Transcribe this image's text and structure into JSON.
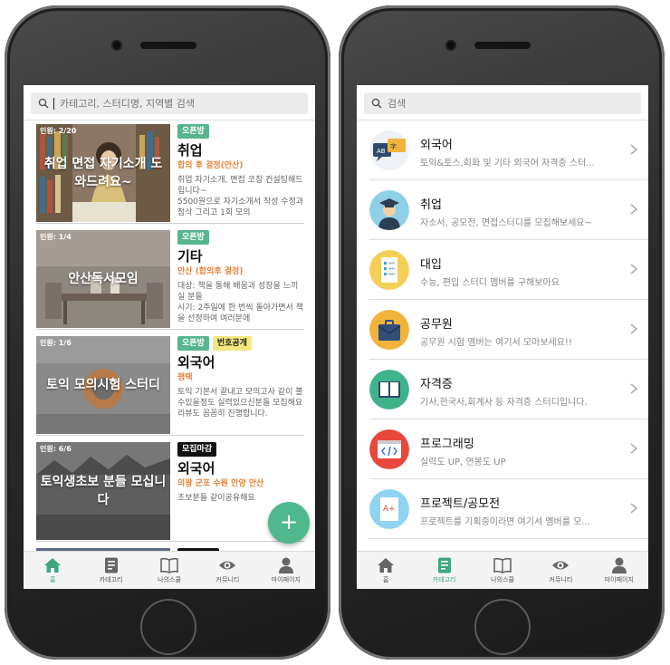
{
  "left_screen": {
    "search_placeholder": "카테고리, 스터디명, 지역별 검색",
    "cards": [
      {
        "count": "인원: 2/20",
        "thumb_title": "취업 면접 자기소개 도와드려요~",
        "tags": [
          "오픈방"
        ],
        "category": "취업",
        "place": "합의 후 결정(안산)",
        "desc": "취업 자기소개, 면접 코칭 컨설팅해드립니다~\n5500원으로 자기소개서 작성 수정과 첨삭 그리고 1회 모의"
      },
      {
        "count": "인원: 1/4",
        "thumb_title": "안산독서모임",
        "tags": [
          "오픈방"
        ],
        "category": "기타",
        "place": "안산 (합의후 결정)",
        "desc": "대상: 책을 통해 배움과 성장을 느끼실 분들\n시기: 2주일에 한 번씩 돌아가면서 책을 선정하여 여러분에"
      },
      {
        "count": "인원: 1/6",
        "thumb_title": "토익 모의시험 스터디",
        "tags": [
          "오픈방",
          "번호공개"
        ],
        "category": "외국어",
        "place": "평택",
        "desc": "토익 기본서 끝내고 모의고사 같이 볼수있을정도 실력있으신분들 모집해요 리뷰도 꼼꼼히 진행합니다."
      },
      {
        "count": "인원: 6/6",
        "thumb_title": "토익생초보 분들 모십니다",
        "tags": [
          "모집마감"
        ],
        "category": "외국어",
        "place": "의왕 군포 수원 안양 안산",
        "desc": "초보분들 같이공유해요"
      }
    ],
    "fab_label": "+"
  },
  "right_screen": {
    "search_placeholder": "검색",
    "categories": [
      {
        "title": "외국어",
        "subtitle": "토익&토스,회화 및 기타 외국어 자격증 스터...",
        "icon": "language-icon"
      },
      {
        "title": "취업",
        "subtitle": "자소서, 공모전, 면접스터디를 모집해보세요~",
        "icon": "graduate-icon"
      },
      {
        "title": "대입",
        "subtitle": "수능, 편입 스터디 멤버를 구해보아요",
        "icon": "checklist-icon"
      },
      {
        "title": "공무원",
        "subtitle": "공무원 시험 멤버는 여기서 모아보세요!!",
        "icon": "briefcase-icon"
      },
      {
        "title": "자격증",
        "subtitle": "기사,한국사,회계사 등 자격증 스터디입니다.",
        "icon": "book-icon"
      },
      {
        "title": "프로그래밍",
        "subtitle": "실력도 UP, 연봉도 UP",
        "icon": "code-icon"
      },
      {
        "title": "프로젝트/공모전",
        "subtitle": "프로젝트를 기획중이라면 여기서 멤버를 모...",
        "icon": "document-icon"
      }
    ]
  },
  "nav": {
    "items": [
      "홈",
      "카테고리",
      "나의스쿨",
      "커뮤니티",
      "마이페이지"
    ],
    "left_active": 0,
    "right_active": 1,
    "active_color": "#3fa77f"
  },
  "colors": {
    "open_tag": "#57b58f",
    "number_tag": "#f4e87e",
    "closed_tag": "#111111",
    "place_text": "#e8823a",
    "fab": "#4fb98d"
  }
}
